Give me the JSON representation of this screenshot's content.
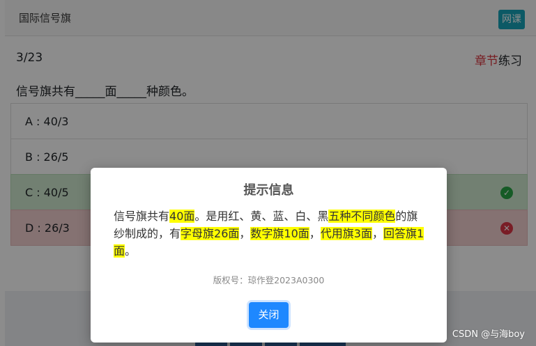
{
  "header": {
    "title": "国际信号旗",
    "course_button": "网课"
  },
  "progress": "3/23",
  "chapter": {
    "red": "章节",
    "black": "练习"
  },
  "question": "信号旗共有_____面_____种颜色。",
  "options": [
    {
      "label": "A : 40/3",
      "state": "normal"
    },
    {
      "label": "B : 26/5",
      "state": "normal"
    },
    {
      "label": "C : 40/5",
      "state": "correct",
      "icon": "check-icon"
    },
    {
      "label": "D : 26/3",
      "state": "wrong",
      "icon": "cross-icon"
    }
  ],
  "modal": {
    "title": "提示信息",
    "body": [
      {
        "text": "信号旗共有",
        "hl": false
      },
      {
        "text": "40面",
        "hl": true
      },
      {
        "text": "。是用红、黄、蓝、白、黑",
        "hl": false
      },
      {
        "text": "五种不同颜色",
        "hl": true
      },
      {
        "text": "的旗纱制成的，有",
        "hl": false
      },
      {
        "text": "字母旗26面",
        "hl": true
      },
      {
        "text": "，",
        "hl": false
      },
      {
        "text": "数字旗10面",
        "hl": true
      },
      {
        "text": "，",
        "hl": false
      },
      {
        "text": "代用旗3面",
        "hl": true
      },
      {
        "text": "，",
        "hl": false
      },
      {
        "text": "回答旗1面",
        "hl": true
      },
      {
        "text": "。",
        "hl": false
      }
    ],
    "copyright": "版权号：琼作登2023A0300",
    "close_button": "关闭"
  },
  "watermark": "CSDN @与海boy",
  "colors": {
    "accent": "#1e88ff",
    "teal": "#17a2b8",
    "correct": "#28a745",
    "wrong": "#dc3545",
    "highlight": "#ffff00"
  }
}
